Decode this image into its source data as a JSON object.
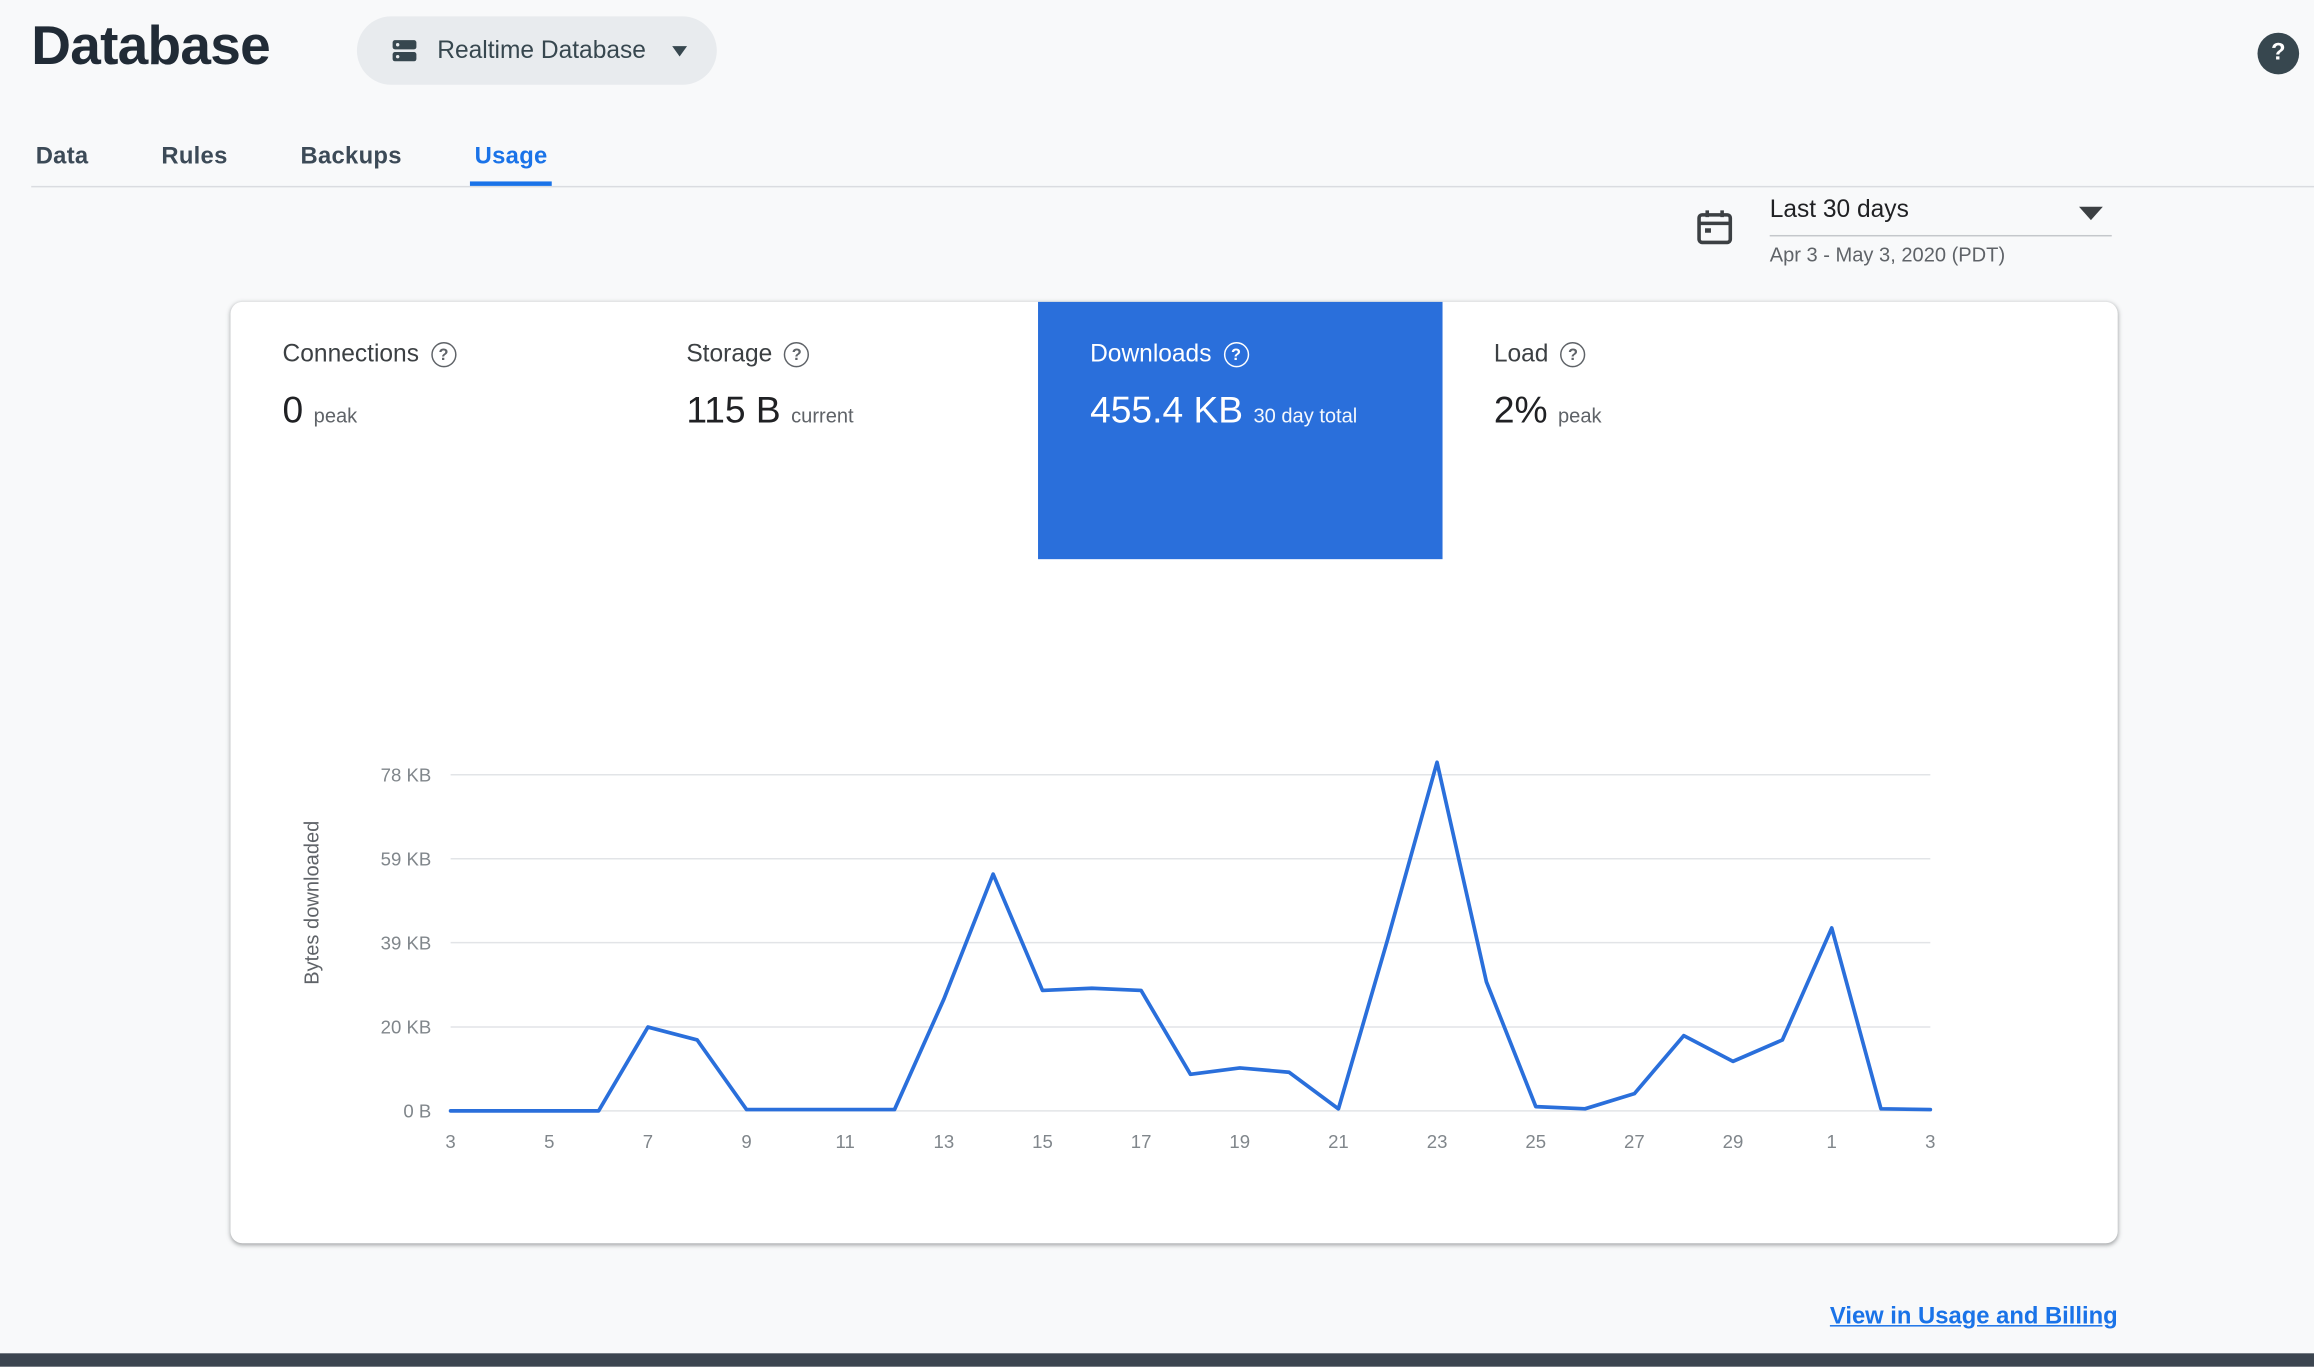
{
  "glyphs": {
    "question": "?"
  },
  "colors": {
    "accent": "#1a73e8",
    "selected_tile": "#2a6fdb",
    "chart_line": "#2a6fdb"
  },
  "header": {
    "title": "Database",
    "instance_selector": {
      "label": "Realtime Database"
    }
  },
  "tabs": [
    {
      "label": "Data",
      "active": false
    },
    {
      "label": "Rules",
      "active": false
    },
    {
      "label": "Backups",
      "active": false
    },
    {
      "label": "Usage",
      "active": true
    }
  ],
  "date_range": {
    "selected": "Last 30 days",
    "detail": "Apr 3 - May 3, 2020 (PDT)"
  },
  "metrics": [
    {
      "label": "Connections",
      "value": "0",
      "unit": "peak",
      "selected": false
    },
    {
      "label": "Storage",
      "value": "115 B",
      "unit": "current",
      "selected": false
    },
    {
      "label": "Downloads",
      "value": "455.4 KB",
      "unit": "30 day total",
      "selected": true
    },
    {
      "label": "Load",
      "value": "2%",
      "unit": "peak",
      "selected": false
    }
  ],
  "chart_data": {
    "type": "line",
    "title": "Downloads",
    "ylabel": "Bytes downloaded",
    "xlabel": "",
    "ylim": [
      0,
      80
    ],
    "grid": true,
    "legend": "none",
    "x": [
      "Apr 3",
      "Apr 4",
      "Apr 5",
      "Apr 6",
      "Apr 7",
      "Apr 8",
      "Apr 9",
      "Apr 10",
      "Apr 11",
      "Apr 12",
      "Apr 13",
      "Apr 14",
      "Apr 15",
      "Apr 16",
      "Apr 17",
      "Apr 18",
      "Apr 19",
      "Apr 20",
      "Apr 21",
      "Apr 22",
      "Apr 23",
      "Apr 24",
      "Apr 25",
      "Apr 26",
      "Apr 27",
      "Apr 28",
      "Apr 29",
      "Apr 30",
      "May 1",
      "May 2",
      "May 3"
    ],
    "x_tick_labels": [
      "3",
      "5",
      "7",
      "9",
      "11",
      "13",
      "15",
      "17",
      "19",
      "21",
      "23",
      "25",
      "27",
      "29",
      "1",
      "3"
    ],
    "y_ticks": [
      {
        "label": "0 B",
        "kb": 0
      },
      {
        "label": "20 KB",
        "kb": 19.5
      },
      {
        "label": "39 KB",
        "kb": 39.1
      },
      {
        "label": "59 KB",
        "kb": 58.6
      },
      {
        "label": "78 KB",
        "kb": 78.1
      }
    ],
    "series": [
      {
        "name": "Bytes downloaded",
        "unit": "KB",
        "values": [
          0,
          0,
          0,
          0,
          19.5,
          16.5,
          0.3,
          0.3,
          0.3,
          0.3,
          26,
          55,
          28,
          28.5,
          28,
          8.5,
          10,
          9,
          0.5,
          40,
          81,
          30,
          1,
          0.5,
          4,
          17.5,
          11.5,
          16.5,
          42.5,
          0.5,
          0.3
        ]
      }
    ]
  },
  "footer": {
    "link_label": "View in Usage and Billing"
  }
}
